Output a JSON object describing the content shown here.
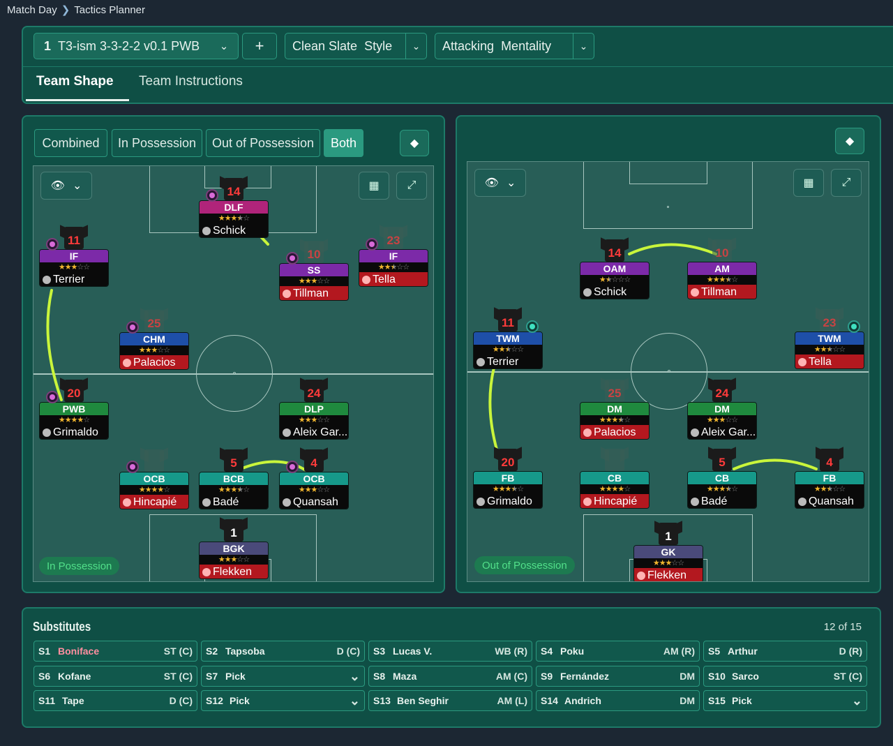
{
  "breadcrumb": {
    "parent": "Match Day",
    "current": "Tactics Planner"
  },
  "tactic": {
    "number": "1",
    "name": "T3-ism 3-3-2-2 v0.1 PWB",
    "add": "+",
    "style_value": "Clean Slate",
    "style_label": "Style",
    "mentality_value": "Attacking",
    "mentality_label": "Mentality"
  },
  "tabs": {
    "shape": "Team Shape",
    "instructions": "Team Instructions"
  },
  "view_toggles": {
    "combined": "Combined",
    "in_possession": "In Possession",
    "out_of_possession": "Out of Possession",
    "both": "Both"
  },
  "left_pitch": {
    "phase": "In Possession",
    "players": [
      {
        "shirt": "14",
        "role": "DLF",
        "role_color": "#b0247a",
        "stars": 3.5,
        "name": "Schick",
        "injured": false,
        "ghost": false
      },
      {
        "shirt": "11",
        "role": "IF",
        "role_color": "#7c2aa8",
        "stars": 3,
        "name": "Terrier",
        "injured": false,
        "ghost": false
      },
      {
        "shirt": "10",
        "role": "SS",
        "role_color": "#7c2aa8",
        "stars": 3,
        "name": "Tillman",
        "injured": true,
        "ghost": true
      },
      {
        "shirt": "23",
        "role": "IF",
        "role_color": "#7c2aa8",
        "stars": 2.5,
        "name": "Tella",
        "injured": true,
        "ghost": true
      },
      {
        "shirt": "25",
        "role": "CHM",
        "role_color": "#1e4fa8",
        "stars": 3,
        "name": "Palacios",
        "injured": true,
        "ghost": true
      },
      {
        "shirt": "20",
        "role": "PWB",
        "role_color": "#1f8a3e",
        "stars": 4,
        "name": "Grimaldo",
        "injured": false,
        "ghost": false
      },
      {
        "shirt": "24",
        "role": "DLP",
        "role_color": "#1f8a3e",
        "stars": 3,
        "name": "Aleix Gar...",
        "injured": false,
        "ghost": false
      },
      {
        "shirt": "",
        "role": "OCB",
        "role_color": "#16998a",
        "stars": 4,
        "name": "Hincapié",
        "injured": true,
        "ghost": true
      },
      {
        "shirt": "5",
        "role": "BCB",
        "role_color": "#16998a",
        "stars": 3.5,
        "name": "Badé",
        "injured": false,
        "ghost": false
      },
      {
        "shirt": "4",
        "role": "OCB",
        "role_color": "#16998a",
        "stars": 3,
        "name": "Quansah",
        "injured": false,
        "ghost": false
      },
      {
        "shirt": "1",
        "role": "BGK",
        "role_color": "#4a4a7a",
        "stars": 3,
        "name": "Flekken",
        "injured": true,
        "ghost": false
      }
    ]
  },
  "right_pitch": {
    "phase": "Out of Possession",
    "players": [
      {
        "shirt": "14",
        "role": "OAM",
        "role_color": "#7c2aa8",
        "stars": 1.5,
        "name": "Schick",
        "injured": false,
        "ghost": false
      },
      {
        "shirt": "10",
        "role": "AM",
        "role_color": "#7c2aa8",
        "stars": 3.5,
        "name": "Tillman",
        "injured": true,
        "ghost": true
      },
      {
        "shirt": "11",
        "role": "TWM",
        "role_color": "#1e4fa8",
        "stars": 2.5,
        "name": "Terrier",
        "injured": false,
        "ghost": false
      },
      {
        "shirt": "23",
        "role": "TWM",
        "role_color": "#1e4fa8",
        "stars": 2.5,
        "name": "Tella",
        "injured": true,
        "ghost": true
      },
      {
        "shirt": "25",
        "role": "DM",
        "role_color": "#1f8a3e",
        "stars": 3.5,
        "name": "Palacios",
        "injured": true,
        "ghost": true
      },
      {
        "shirt": "24",
        "role": "DM",
        "role_color": "#1f8a3e",
        "stars": 3,
        "name": "Aleix Gar...",
        "injured": false,
        "ghost": false
      },
      {
        "shirt": "20",
        "role": "FB",
        "role_color": "#16998a",
        "stars": 3.5,
        "name": "Grimaldo",
        "injured": false,
        "ghost": false
      },
      {
        "shirt": "",
        "role": "CB",
        "role_color": "#16998a",
        "stars": 4,
        "name": "Hincapié",
        "injured": true,
        "ghost": true
      },
      {
        "shirt": "5",
        "role": "CB",
        "role_color": "#16998a",
        "stars": 3.5,
        "name": "Badé",
        "injured": false,
        "ghost": false
      },
      {
        "shirt": "4",
        "role": "FB",
        "role_color": "#16998a",
        "stars": 2.5,
        "name": "Quansah",
        "injured": false,
        "ghost": false
      },
      {
        "shirt": "1",
        "role": "GK",
        "role_color": "#4a4a7a",
        "stars": 3,
        "name": "Flekken",
        "injured": true,
        "ghost": false
      }
    ]
  },
  "substitutes": {
    "title": "Substitutes",
    "count": "12 of 15",
    "items": [
      {
        "slot": "S1",
        "name": "Boniface",
        "pos": "ST (C)",
        "highlight": true
      },
      {
        "slot": "S2",
        "name": "Tapsoba",
        "pos": "D (C)"
      },
      {
        "slot": "S3",
        "name": "Lucas V.",
        "pos": "WB (R)"
      },
      {
        "slot": "S4",
        "name": "Poku",
        "pos": "AM (R)"
      },
      {
        "slot": "S5",
        "name": "Arthur",
        "pos": "D (R)"
      },
      {
        "slot": "S6",
        "name": "Kofane",
        "pos": "ST (C)"
      },
      {
        "slot": "S7",
        "name": "Pick",
        "pos": "",
        "dropdown": true
      },
      {
        "slot": "S8",
        "name": "Maza",
        "pos": "AM (C)"
      },
      {
        "slot": "S9",
        "name": "Fernández",
        "pos": "DM"
      },
      {
        "slot": "S10",
        "name": "Sarco",
        "pos": "ST (C)"
      },
      {
        "slot": "S11",
        "name": "Tape",
        "pos": "D (C)"
      },
      {
        "slot": "S12",
        "name": "Pick",
        "pos": "",
        "dropdown": true
      },
      {
        "slot": "S13",
        "name": "Ben Seghir",
        "pos": "AM (L)"
      },
      {
        "slot": "S14",
        "name": "Andrich",
        "pos": "DM"
      },
      {
        "slot": "S15",
        "name": "Pick",
        "pos": "",
        "dropdown": true
      }
    ]
  },
  "icons": {
    "breadcrumb_sep": "chevron-right-icon",
    "dropdown": "chevron-down-icon",
    "eye": "eye-icon",
    "grid": "grid-icon",
    "fullscreen": "expand-icon",
    "pitch": "pitch-icon",
    "player": "person-icon"
  }
}
